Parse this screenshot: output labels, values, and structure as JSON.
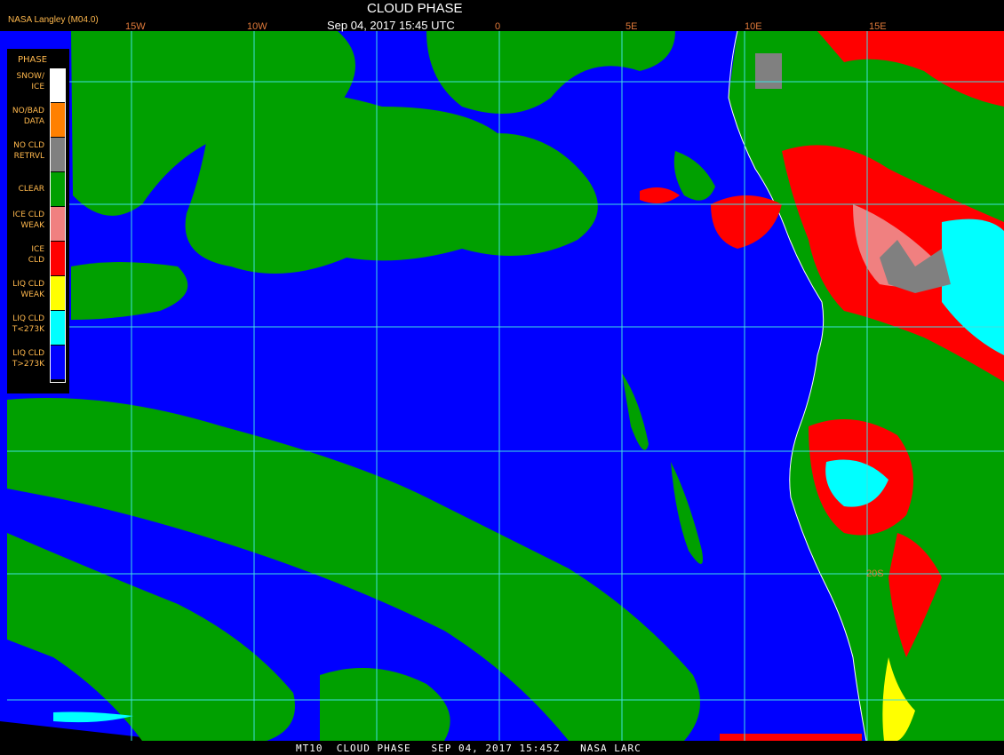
{
  "header": {
    "org": "NASA Langley (M04.0)",
    "title": "CLOUD PHASE",
    "timestamp": "Sep 04, 2017 15:45 UTC"
  },
  "lon_labels": [
    "15W",
    "10W",
    "0",
    "5E",
    "10E",
    "15E"
  ],
  "lat_labels": [
    "20S"
  ],
  "legend": {
    "title": "PHASE",
    "items": [
      {
        "label": "SNOW/ ICE",
        "color": "#ffffff"
      },
      {
        "label": "NO/BAD DATA",
        "color": "#ff8000"
      },
      {
        "label": "NO CLD RETRVL",
        "color": "#808080"
      },
      {
        "label": "CLEAR",
        "color": "#00a000"
      },
      {
        "label": "ICE CLD WEAK",
        "color": "#f08080"
      },
      {
        "label": "ICE CLD",
        "color": "#ff0000"
      },
      {
        "label": "LIQ CLD WEAK",
        "color": "#ffff00"
      },
      {
        "label": "LIQ CLD T<273K",
        "color": "#00ffff"
      },
      {
        "label": "LIQ CLD T>273K",
        "color": "#0000ff"
      }
    ]
  },
  "footer": {
    "text": "MT10  CLOUD PHASE   SEP 04, 2017 15:45Z   NASA LARC"
  },
  "colors": {
    "ocean": "#0000ff",
    "land": "#00a000",
    "grid": "#40e0e0",
    "coast": "#ffffff"
  }
}
